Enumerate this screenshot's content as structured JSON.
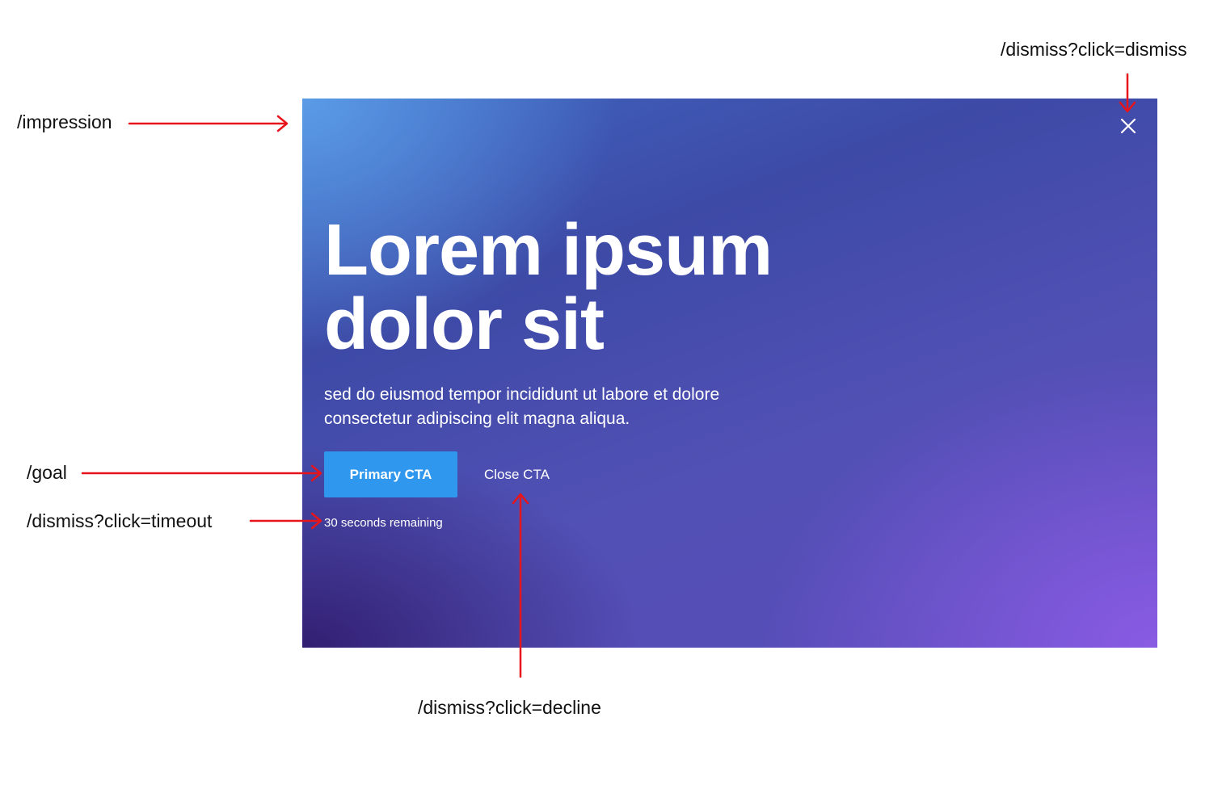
{
  "modal": {
    "headline_line1": "Lorem ipsum",
    "headline_line2": "dolor sit",
    "body_line1": "sed do eiusmod tempor incididunt ut labore et dolore",
    "body_line2": "consectetur adipiscing elit magna aliqua.",
    "primary_cta_label": "Primary CTA",
    "close_cta_label": "Close CTA",
    "timer_text": "30 seconds remaining",
    "close_icon": "close-icon",
    "primary_color": "#2f97ed"
  },
  "annotations": {
    "impression": "/impression",
    "dismiss": "/dismiss?click=dismiss",
    "goal": "/goal",
    "timeout": "/dismiss?click=timeout",
    "decline": "/dismiss?click=decline",
    "arrow_color": "#e8141b",
    "arrow_icon": "arrow-icon"
  }
}
